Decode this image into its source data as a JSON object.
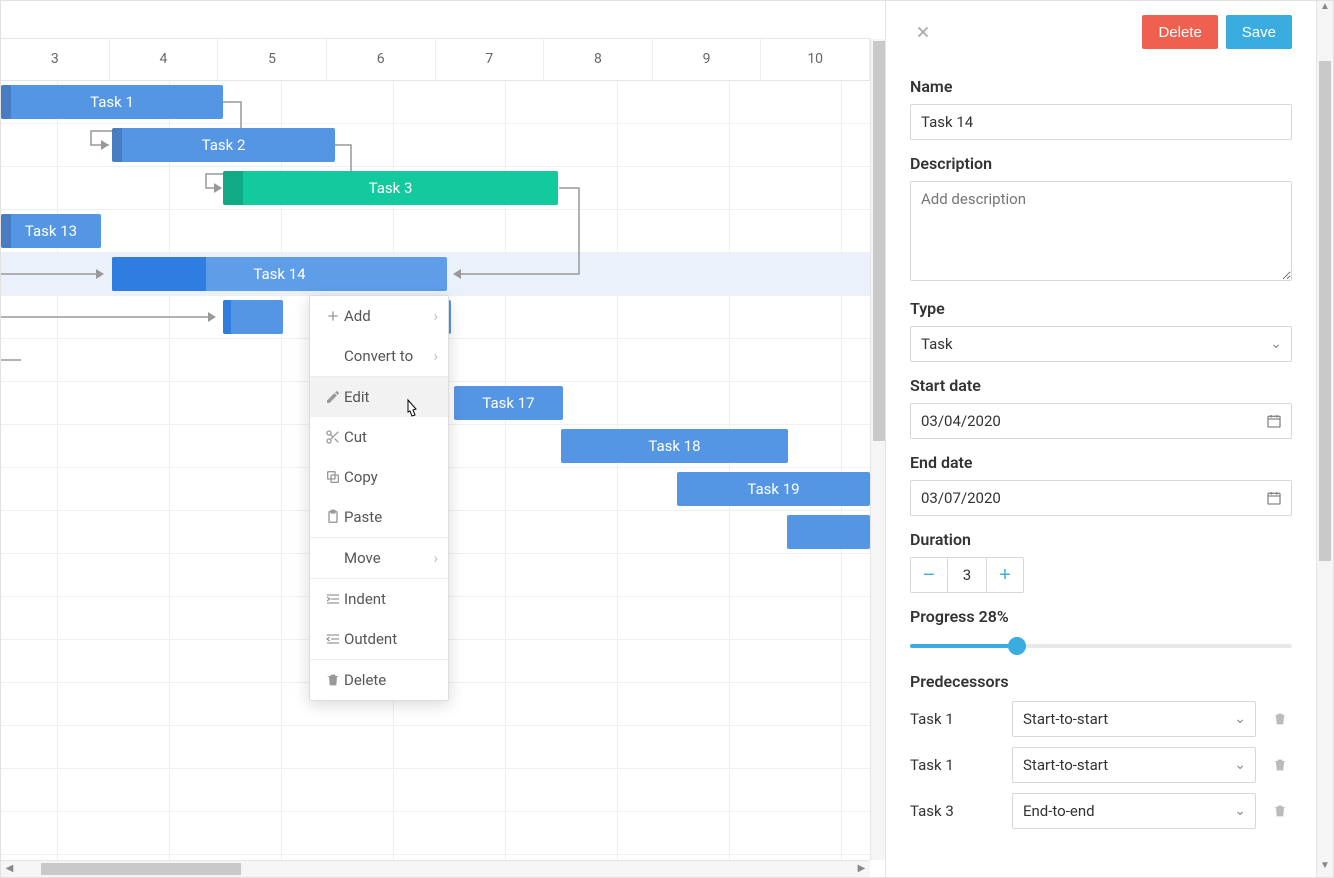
{
  "timeline": {
    "columns": [
      "3",
      "4",
      "5",
      "6",
      "7",
      "8",
      "9",
      "10"
    ]
  },
  "tasks": {
    "t1": {
      "label": "Task 1"
    },
    "t2": {
      "label": "Task 2"
    },
    "t3": {
      "label": "Task 3"
    },
    "t13": {
      "label": "Task 13"
    },
    "t14": {
      "label": "Task 14"
    },
    "t17": {
      "label": "Task 17"
    },
    "t18": {
      "label": "Task 18"
    },
    "t19": {
      "label": "Task 19"
    }
  },
  "contextMenu": {
    "add": "Add",
    "convert": "Convert to",
    "edit": "Edit",
    "cut": "Cut",
    "copy": "Copy",
    "paste": "Paste",
    "move": "Move",
    "indent": "Indent",
    "outdent": "Outdent",
    "delete": "Delete"
  },
  "panel": {
    "delete": "Delete",
    "save": "Save",
    "nameLabel": "Name",
    "nameValue": "Task 14",
    "descLabel": "Description",
    "descPlaceholder": "Add description",
    "typeLabel": "Type",
    "typeValue": "Task",
    "startLabel": "Start date",
    "startValue": "03/04/2020",
    "endLabel": "End date",
    "endValue": "03/07/2020",
    "durationLabel": "Duration",
    "durationValue": "3",
    "progressLabel": "Progress 28%",
    "progressPercent": 28,
    "predecessorsLabel": "Predecessors",
    "predecessors": [
      {
        "task": "Task 1",
        "link": "Start-to-start"
      },
      {
        "task": "Task 1",
        "link": "Start-to-start"
      },
      {
        "task": "Task 3",
        "link": "End-to-end"
      }
    ]
  }
}
